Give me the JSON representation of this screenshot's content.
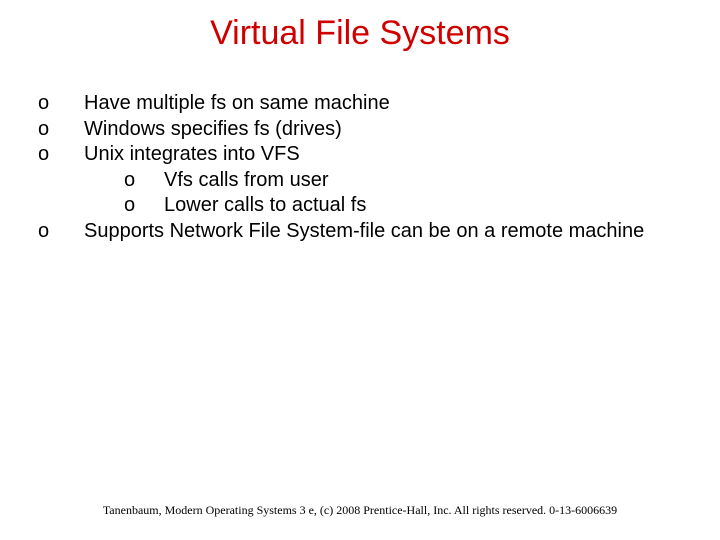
{
  "title": "Virtual File Systems",
  "bullets": {
    "i0": "Have multiple fs on same machine",
    "i1": "Windows specifies fs (drives)",
    "i2": "Unix integrates into VFS",
    "i2_0": "Vfs calls from user",
    "i2_1": "Lower calls to actual fs",
    "i3": "Supports Network File System-file can be on a remote machine"
  },
  "marker": "o",
  "footer": "Tanenbaum, Modern Operating Systems 3 e, (c) 2008 Prentice-Hall, Inc. All rights reserved. 0-13-6006639"
}
